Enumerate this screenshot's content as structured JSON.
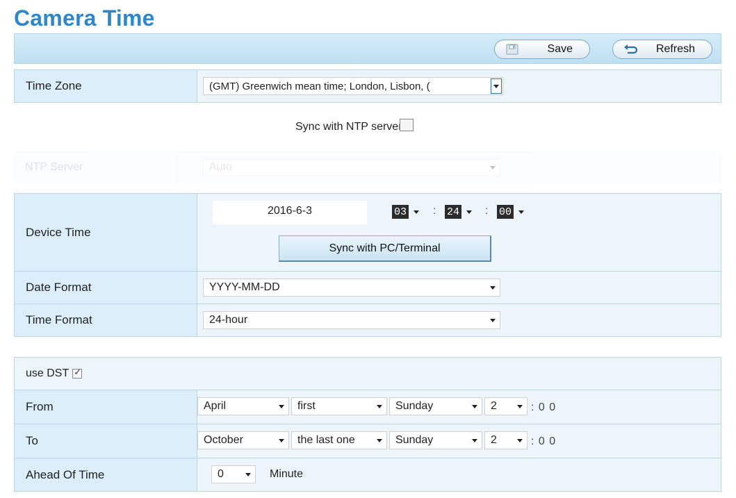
{
  "page": {
    "title": "Camera Time"
  },
  "toolbar": {
    "save_label": "Save",
    "refresh_label": "Refresh"
  },
  "time_zone": {
    "label": "Time Zone",
    "value": "(GMT) Greenwich mean time; London, Lisbon, ("
  },
  "ntp": {
    "sync_label": "Sync with NTP server",
    "sync_checked": false,
    "server_label": "NTP Server",
    "server_value": "Auto"
  },
  "device_time": {
    "label": "Device Time",
    "date": "2016-6-3",
    "hour": "03",
    "minute": "24",
    "second": "00",
    "colon": ":",
    "sync_button": "Sync with PC/Terminal"
  },
  "date_format": {
    "label": "Date Format",
    "value": "YYYY-MM-DD"
  },
  "time_format": {
    "label": "Time Format",
    "value": "24-hour"
  },
  "dst": {
    "label": "use DST",
    "checked": true,
    "from": {
      "label": "From",
      "month": "April",
      "week": "first",
      "day": "Sunday",
      "hour": "2",
      "suffix": ": 0 0"
    },
    "to": {
      "label": "To",
      "month": "October",
      "week": "the last one",
      "day": "Sunday",
      "hour": "2",
      "suffix": ": 0 0"
    },
    "ahead": {
      "label": "Ahead Of Time",
      "value": "0",
      "unit": "Minute"
    }
  },
  "colors": {
    "title": "#2f86c8",
    "label_bg": "#dbeef9",
    "value_bg": "#edf5fb",
    "border": "#b9d7e8"
  },
  "icons": {
    "save": "floppy-disk-icon",
    "refresh": "refresh-arrow-icon",
    "dropdown": "chevron-down-icon"
  }
}
